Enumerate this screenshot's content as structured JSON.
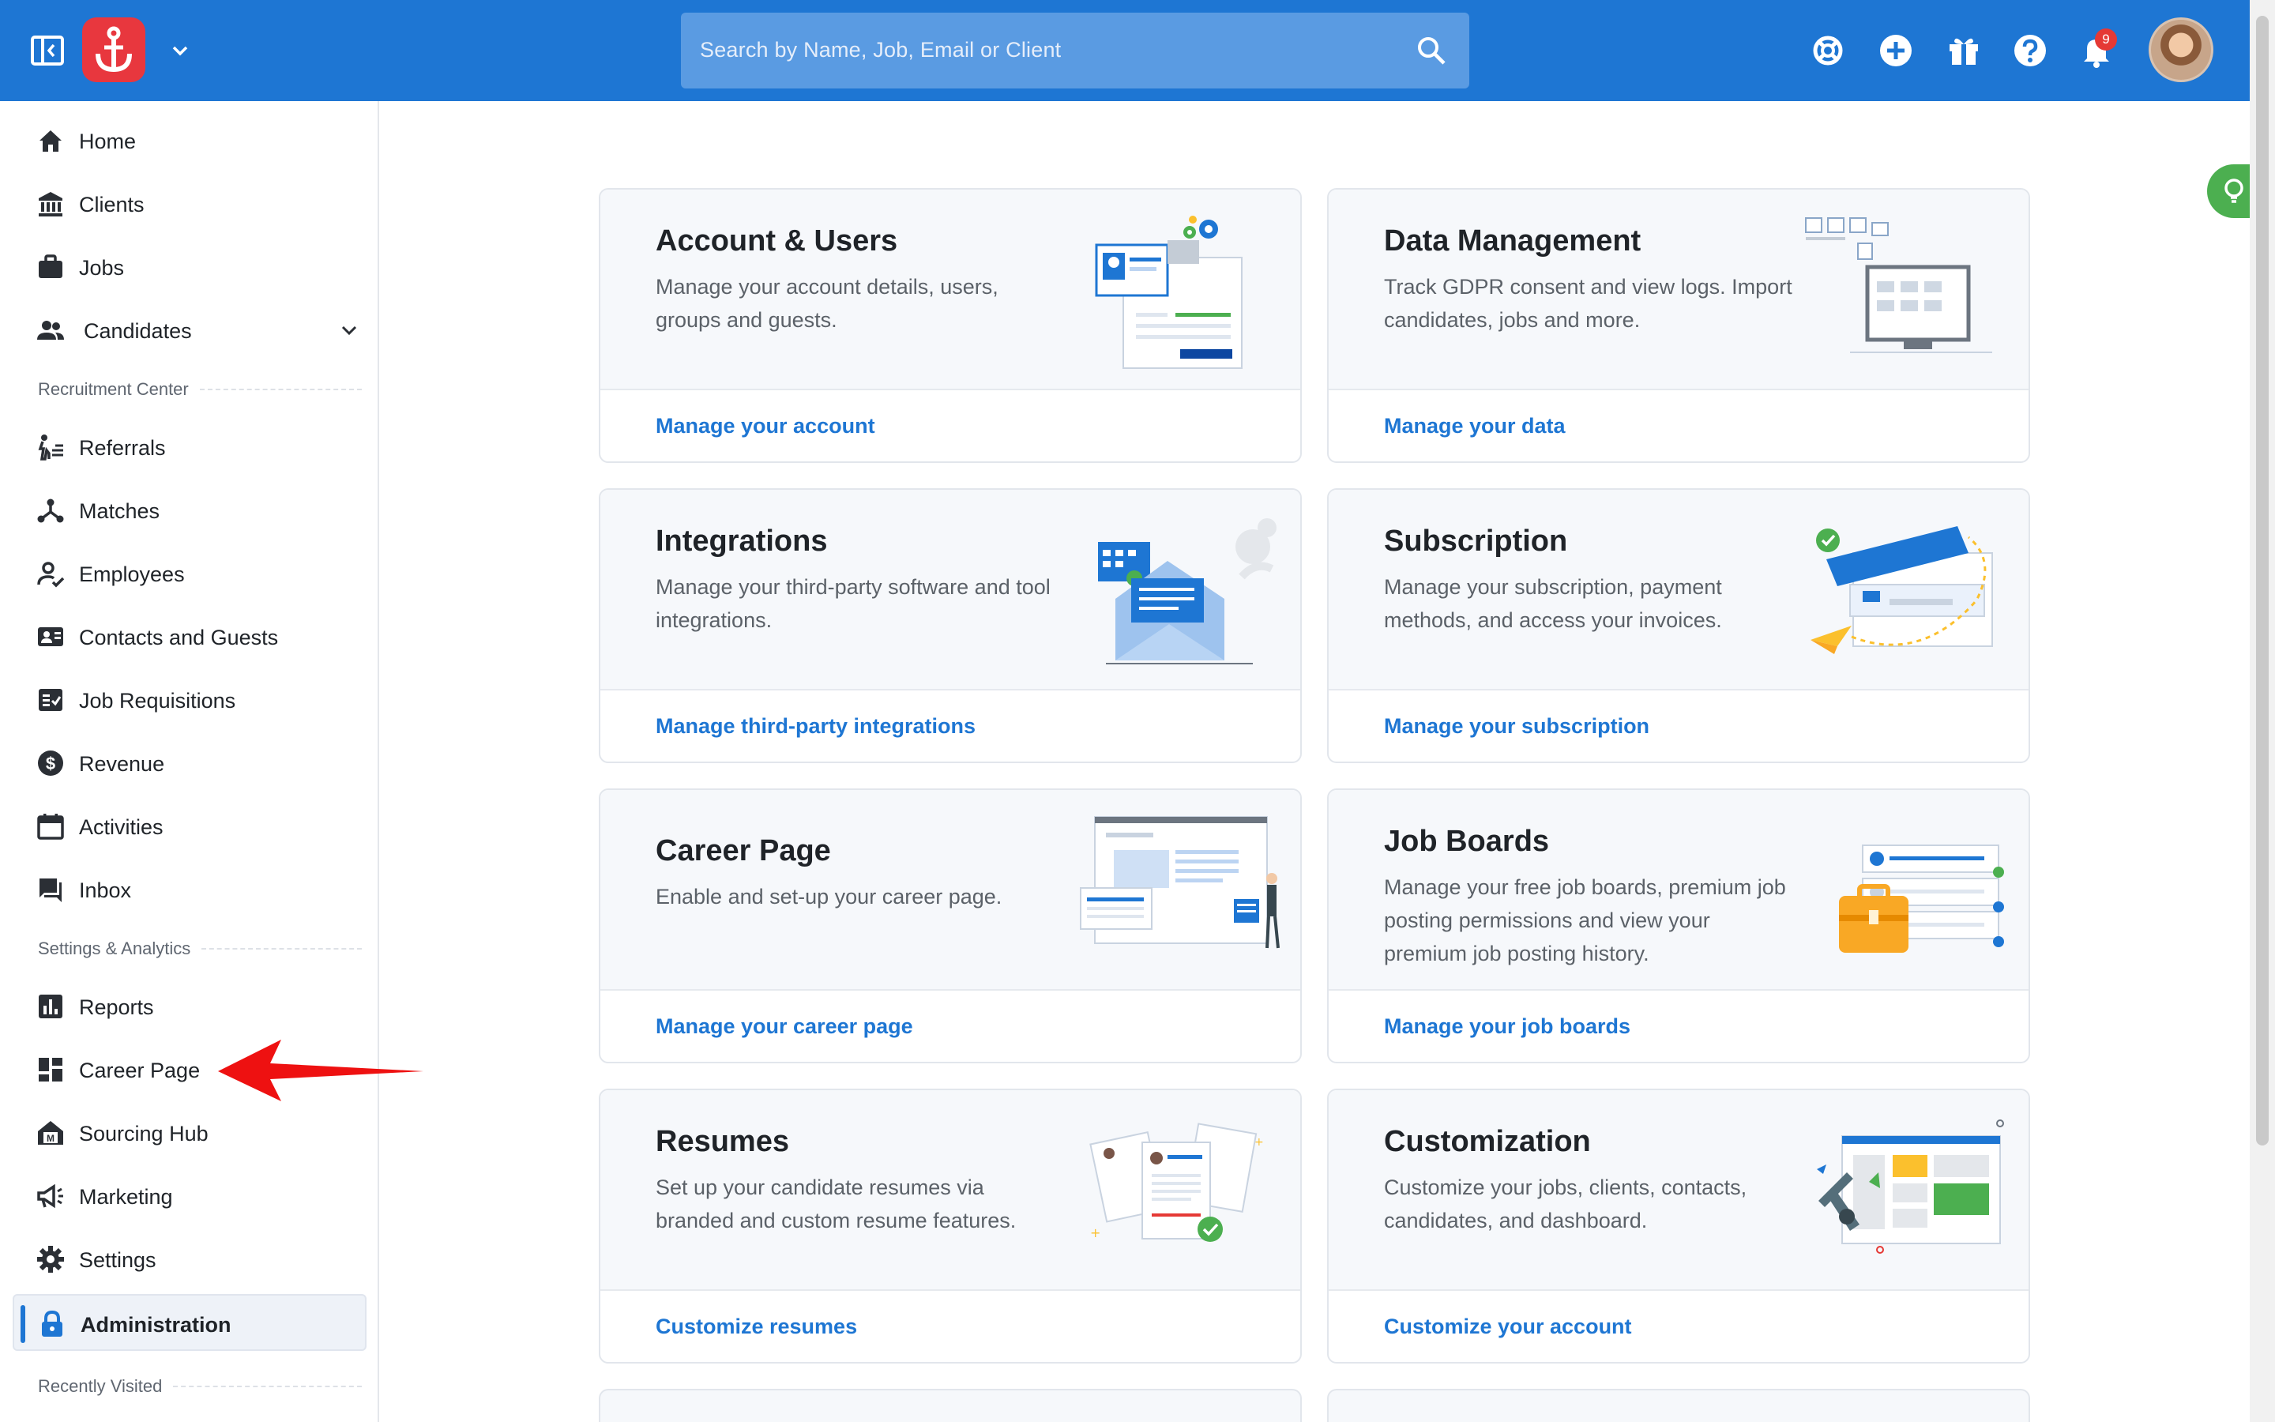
{
  "topbar": {
    "search_placeholder": "Search by Name, Job, Email or Client",
    "notification_count": "9",
    "colors": {
      "bar": "#1e76d3",
      "logo": "#e8373e",
      "badge": "#e53935"
    },
    "icons": [
      "panel-toggle-icon",
      "app-logo",
      "chevron-down-icon",
      "search-icon",
      "help-center-icon",
      "plus-icon",
      "gift-icon",
      "question-icon",
      "bell-icon"
    ]
  },
  "sidebar": {
    "items": [
      {
        "label": "Home",
        "icon": "home-icon"
      },
      {
        "label": "Clients",
        "icon": "bank-icon"
      },
      {
        "label": "Jobs",
        "icon": "briefcase-icon"
      },
      {
        "label": "Candidates",
        "icon": "people-icon"
      },
      {
        "label": "Referrals",
        "icon": "referrals-icon"
      },
      {
        "label": "Matches",
        "icon": "matches-icon"
      },
      {
        "label": "Employees",
        "icon": "employee-icon"
      },
      {
        "label": "Contacts and Guests",
        "icon": "contacts-icon"
      },
      {
        "label": "Job Requisitions",
        "icon": "requisition-icon"
      },
      {
        "label": "Revenue",
        "icon": "dollar-icon"
      },
      {
        "label": "Activities",
        "icon": "calendar-icon"
      },
      {
        "label": "Inbox",
        "icon": "inbox-icon"
      },
      {
        "label": "Reports",
        "icon": "reports-icon"
      },
      {
        "label": "Career Page",
        "icon": "dashboard-icon"
      },
      {
        "label": "Sourcing Hub",
        "icon": "sourcing-icon"
      },
      {
        "label": "Marketing",
        "icon": "megaphone-icon"
      },
      {
        "label": "Settings",
        "icon": "gear-icon"
      },
      {
        "label": "Administration",
        "icon": "lock-icon"
      }
    ],
    "sections": {
      "recruitment": "Recruitment Center",
      "settings": "Settings & Analytics",
      "recent": "Recently Visited"
    },
    "active_item": "Administration"
  },
  "cards": [
    {
      "title": "Account & Users",
      "desc": "Manage your account details, users, groups and guests.",
      "link": "Manage your account"
    },
    {
      "title": "Data Management",
      "desc": "Track GDPR consent and view logs. Import candidates, jobs and more.",
      "link": "Manage your data"
    },
    {
      "title": "Integrations",
      "desc": "Manage your third-party software and tool integrations.",
      "link": "Manage third-party integrations"
    },
    {
      "title": "Subscription",
      "desc": "Manage your subscription, payment methods, and access your invoices.",
      "link": "Manage your subscription"
    },
    {
      "title": "Career Page",
      "desc": "Enable and set-up your career page.",
      "link": "Manage your career page"
    },
    {
      "title": "Job Boards",
      "desc": "Manage your free job boards, premium job posting permissions and view your premium job posting history.",
      "link": "Manage your job boards"
    },
    {
      "title": "Resumes",
      "desc": "Set up your candidate resumes via branded and custom resume features.",
      "link": "Customize resumes"
    },
    {
      "title": "Customization",
      "desc": "Customize your jobs, clients, contacts, candidates, and dashboard.",
      "link": "Customize your account"
    }
  ]
}
